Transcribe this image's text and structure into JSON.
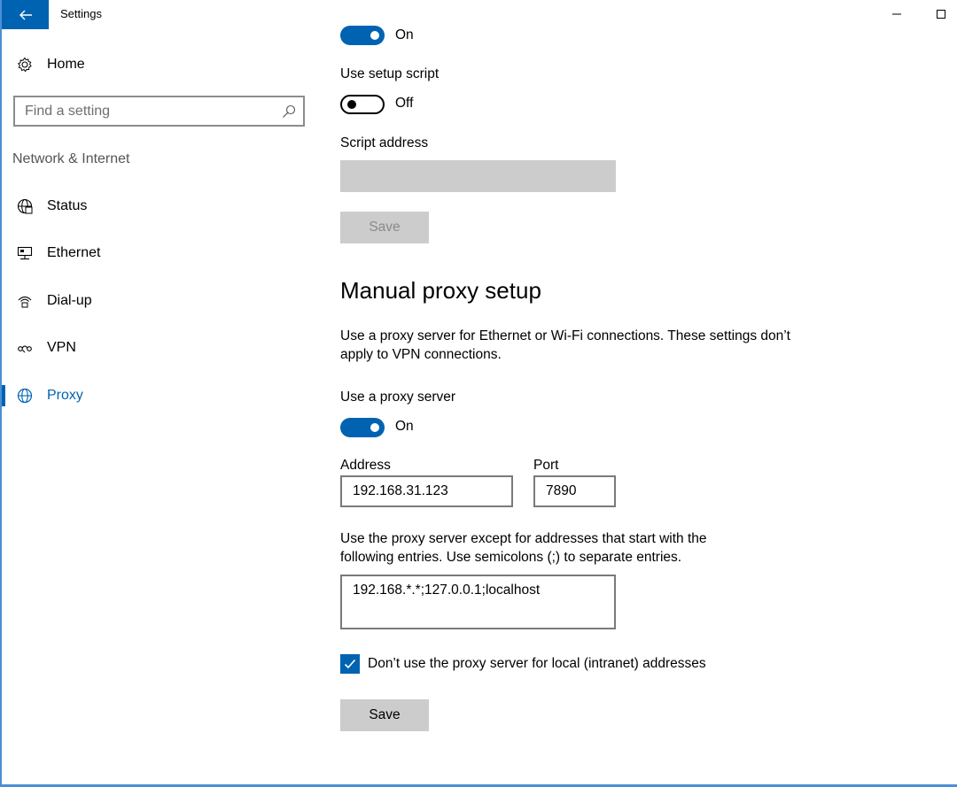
{
  "window": {
    "title": "Settings",
    "minimize_label": "–",
    "maximize_label": "□"
  },
  "sidebar": {
    "home_label": "Home",
    "search": {
      "placeholder": "Find a setting"
    },
    "section_title": "Network & Internet",
    "items": [
      {
        "label": "Status",
        "icon": "globe-status-icon"
      },
      {
        "label": "Ethernet",
        "icon": "ethernet-icon"
      },
      {
        "label": "Dial-up",
        "icon": "dialup-icon"
      },
      {
        "label": "VPN",
        "icon": "vpn-icon"
      },
      {
        "label": "Proxy",
        "icon": "globe-icon",
        "active": true
      }
    ]
  },
  "automatic": {
    "detect_toggle_state": "On",
    "setup_script_label": "Use setup script",
    "setup_script_state": "Off",
    "script_address_label": "Script address",
    "script_address_value": "",
    "save_label": "Save"
  },
  "manual": {
    "heading": "Manual proxy setup",
    "description": "Use a proxy server for Ethernet or Wi-Fi connections. These settings don’t apply to VPN connections.",
    "use_proxy_label": "Use a proxy server",
    "use_proxy_state": "On",
    "address_label": "Address",
    "address_value": "192.168.31.123",
    "port_label": "Port",
    "port_value": "7890",
    "exceptions_description": "Use the proxy server except for addresses that start with the following entries. Use semicolons (;) to separate entries.",
    "exceptions_value": "192.168.*.*;127.0.0.1;localhost",
    "local_checkbox_label": "Don’t use the proxy server for local (intranet) addresses",
    "local_checkbox_checked": true,
    "save_label": "Save"
  },
  "colors": {
    "accent": "#0063b1",
    "button_gray": "#cccccc"
  }
}
